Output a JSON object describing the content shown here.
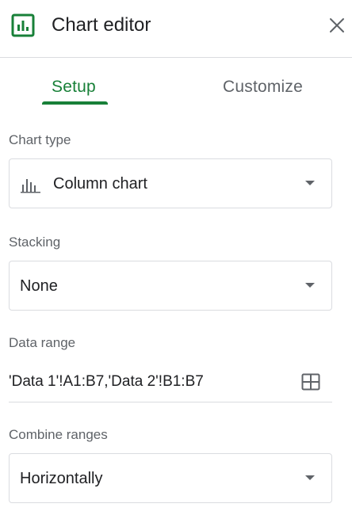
{
  "header": {
    "title": "Chart editor",
    "logo_icon": "sheets-chart-icon",
    "close_icon": "close-icon"
  },
  "tabs": [
    {
      "label": "Setup",
      "active": true
    },
    {
      "label": "Customize",
      "active": false
    }
  ],
  "chart_type": {
    "label": "Chart type",
    "value": "Column chart",
    "icon": "column-chart-icon"
  },
  "stacking": {
    "label": "Stacking",
    "value": "None"
  },
  "data_range": {
    "label": "Data range",
    "value": "'Data 1'!A1:B7,'Data 2'!B1:B7",
    "icon": "select-range-grid-icon"
  },
  "combine_ranges": {
    "label": "Combine ranges",
    "value": "Horizontally"
  },
  "colors": {
    "accent": "#188038",
    "text_primary": "#202124",
    "text_secondary": "#5f6368",
    "border": "#dadce0"
  }
}
